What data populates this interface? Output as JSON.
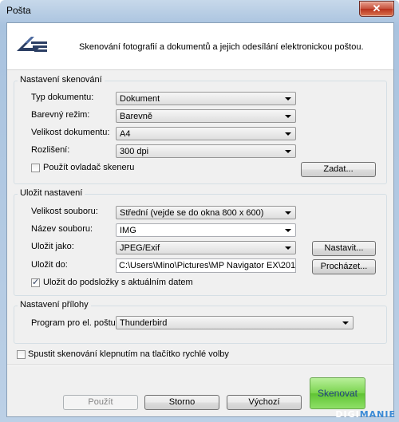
{
  "window": {
    "title": "Pošta",
    "close_symbol": "✕"
  },
  "header": {
    "description": "Skenování fotografií a dokumentů a jejich odesílání elektronickou poštou."
  },
  "scan_settings": {
    "title": "Nastavení skenování",
    "document_type_label": "Typ dokumentu:",
    "document_type_value": "Dokument",
    "color_mode_label": "Barevný režim:",
    "color_mode_value": "Barevně",
    "document_size_label": "Velikost dokumentu:",
    "document_size_value": "A4",
    "resolution_label": "Rozlišení:",
    "resolution_value": "300 dpi",
    "use_driver_label": "Použít ovladač skeneru",
    "use_driver_checked": false,
    "specify_button": "Zadat..."
  },
  "save_settings": {
    "title": "Uložit nastavení",
    "file_size_label": "Velikost souboru:",
    "file_size_value": "Střední (vejde se do okna 800 x 600)",
    "file_name_label": "Název souboru:",
    "file_name_value": "IMG",
    "save_as_label": "Uložit jako:",
    "save_as_value": "JPEG/Exif",
    "set_button": "Nastavit...",
    "save_in_label": "Uložit do:",
    "save_in_value": "C:\\Users\\Mino\\Pictures\\MP Navigator EX\\2011_12_",
    "browse_button": "Procházet...",
    "subfolder_label": "Uložit do podsložky s aktuálním datem",
    "subfolder_checked": true
  },
  "attachment_settings": {
    "title": "Nastavení přílohy",
    "email_program_label": "Program pro el. poštu:",
    "email_program_value": "Thunderbird"
  },
  "quick_start": {
    "label": "Spustit skenování klepnutím na tlačítko rychlé volby",
    "checked": false
  },
  "footer": {
    "apply_button": "Použít",
    "cancel_button": "Storno",
    "defaults_button": "Výchozí",
    "scan_button": "Skenovat"
  },
  "watermark": {
    "part1": "DIGI",
    "part2": "MANIE"
  }
}
